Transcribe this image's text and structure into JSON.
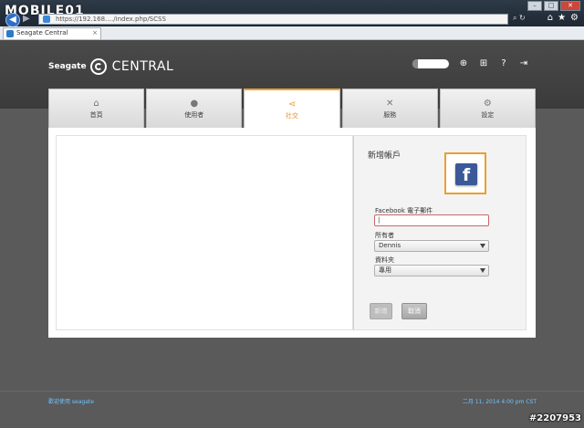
{
  "browser": {
    "watermark": "MOBILE01",
    "address": "https://192.168.…/index.php/SCSS",
    "tab_title": "Seagate Central",
    "tab_close": "×",
    "back_icon": "left-arrow-icon",
    "forward_icon": "right-arrow-icon"
  },
  "header": {
    "brand_name": "Seagate",
    "product_name": "CENTRAL"
  },
  "tabs": [
    {
      "label": "首頁",
      "icon": "home-icon"
    },
    {
      "label": "使用者",
      "icon": "user-icon"
    },
    {
      "label": "社交",
      "icon": "share-icon",
      "active": true
    },
    {
      "label": "服務",
      "icon": "tools-icon"
    },
    {
      "label": "設定",
      "icon": "gears-icon"
    }
  ],
  "side_panel": {
    "title": "新增帳戶",
    "service_logo": "f",
    "email_label": "Facebook 電子郵件",
    "email_value": "|",
    "owner_label": "所有者",
    "owner_value": "Dennis",
    "folder_label": "資料夾",
    "folder_value": "專用",
    "submit_label": "新增",
    "cancel_label": "取消"
  },
  "footer": {
    "welcome": "歡迎使用 seagate",
    "datetime": "二月 11, 2014 4:00 pm CST"
  },
  "watermark_id": "#2207953",
  "colors": {
    "accent": "#f0a030",
    "facebook": "#3b5998",
    "footer_link": "#6ec3ff"
  }
}
